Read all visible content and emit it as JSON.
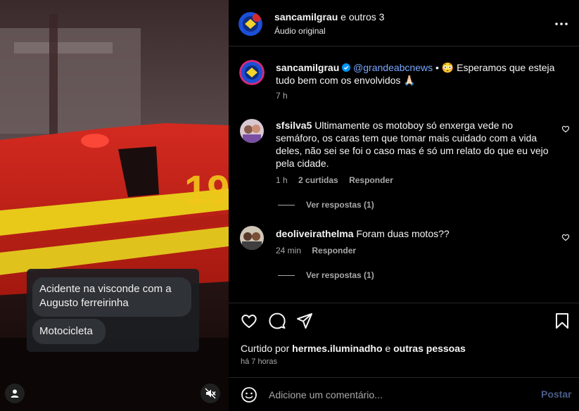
{
  "media": {
    "overlay_messages": [
      "Acidente na visconde com a Augusto ferreirinha",
      "Motocicleta"
    ],
    "user_icon": "user-icon",
    "mute_icon": "speaker-muted-icon"
  },
  "header": {
    "username": "sancamilgrau",
    "collab_suffix": "e outros 3",
    "audio": "Áudio original",
    "more_icon": "more-horizontal-icon"
  },
  "caption": {
    "username": "sancamilgrau",
    "verified": true,
    "mention": "@grandeabcnews",
    "separator": "•",
    "emoji": "😳",
    "text": "Esperamos que esteja tudo bem com os envolvidos 🙏🏻",
    "time": "7 h"
  },
  "comments": [
    {
      "username": "sfsilva5",
      "text": "Ultimamente os motoboy só enxerga vede no semáforo, os caras tem que tomar mais cuidado com a vida deles, não sei se foi o caso mas é só um relato do que eu vejo pela cidade.",
      "time": "1 h",
      "likes": "2 curtidas",
      "reply": "Responder",
      "view_replies": "Ver respostas (1)"
    },
    {
      "username": "deoliveirathelma",
      "text": "Foram duas motos??",
      "time": "24 min",
      "reply": "Responder",
      "view_replies": "Ver respostas (1)"
    }
  ],
  "actions": {
    "like_icon": "heart-icon",
    "comment_icon": "comment-icon",
    "share_icon": "share-icon",
    "save_icon": "bookmark-icon"
  },
  "liked_by": {
    "prefix": "Curtido por",
    "user": "hermes.iluminadho",
    "connector": "e",
    "others": "outras pessoas"
  },
  "posted_time": "há 7 horas",
  "composer": {
    "placeholder": "Adicione um comentário...",
    "post_label": "Postar",
    "emoji_icon": "emoji-icon"
  },
  "colors": {
    "background": "#000000",
    "mention": "#7aa7ff",
    "muted_text": "#a8a8a8",
    "post_disabled": "#4a5d88",
    "verified": "#0095f6"
  }
}
